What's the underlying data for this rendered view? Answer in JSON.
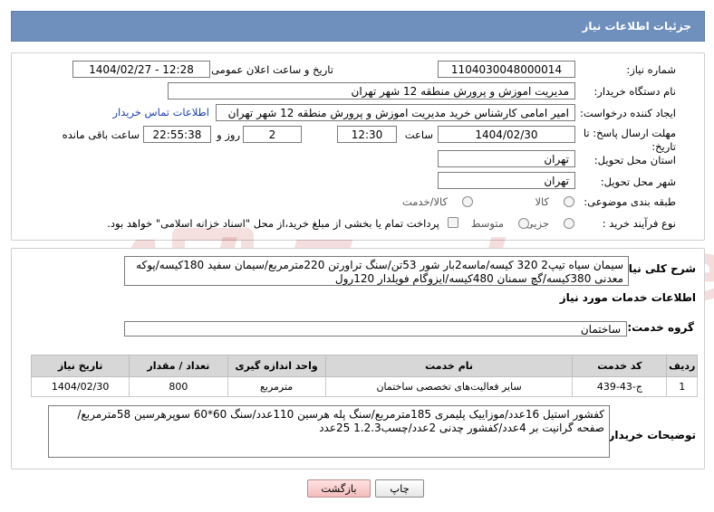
{
  "header": {
    "title": "جزئیات اطلاعات نیاز"
  },
  "fields": {
    "need_number_label": "شماره نیاز:",
    "need_number": "1104030048000014",
    "announce_label": "تاریخ و ساعت اعلان عمومی:",
    "announce_value": "1404/02/27 - 12:28",
    "buyer_org_label": "نام دستگاه خریدار:",
    "buyer_org": "مدیریت اموزش و پرورش منطقه 12 شهر تهران",
    "requester_label": "ایجاد کننده درخواست:",
    "requester": "امیر امامی کارشناس خرید مدیریت اموزش و پرورش منطقه 12 شهر تهران",
    "contact_link": "اطلاعات تماس خریدار",
    "deadline_label": "مهلت ارسال پاسخ: تا تاریخ:",
    "deadline_date": "1404/02/30",
    "time_label": "ساعت",
    "deadline_time": "12:30",
    "days_value": "2",
    "days_label": "روز و",
    "remaining_time": "22:55:38",
    "remaining_label": "ساعت باقی مانده",
    "province_label": "استان محل تحویل:",
    "province": "تهران",
    "city_label": "شهر محل تحویل:",
    "city": "تهران",
    "category_label": "طبقه بندی موضوعی:",
    "category_options": [
      "کالا",
      "کالا/خدمت"
    ],
    "process_label": "نوع فرآیند خرید :",
    "process_options": [
      "جزیی",
      "متوسط"
    ],
    "payment_note": "پرداخت تمام یا بخشی از مبلغ خرید،از محل \"اسناد خزانه اسلامی\" خواهد بود."
  },
  "description": {
    "label": "شرح کلی نیاز:",
    "text": "سیمان سیاه تیپ2 320 کیسه/ماسه2بار شور 53تن/سنگ تراورتن 220مترمربع/سیمان سفید 180کیسه/پوکه معدنی 380کیسه/گچ سمنان 480کیسه/ایزوگام فویلدار 120رول"
  },
  "services": {
    "section_title": "اطلاعات خدمات مورد نیاز",
    "group_label": "گروه خدمت:",
    "group_value": "ساختمان",
    "columns": [
      "ردیف",
      "کد خدمت",
      "نام خدمت",
      "واحد اندازه گیری",
      "تعداد / مقدار",
      "تاریخ نیاز"
    ],
    "rows": [
      [
        "1",
        "ج-43-439",
        "سایر فعالیت‌های تخصصی ساختمان",
        "مترمربع",
        "800",
        "1404/02/30"
      ]
    ]
  },
  "buyer_notes": {
    "label": "توضیحات خریدار:",
    "text": "کفشور استیل 16عدد/موزاییک پلیمری 185مترمربع/سنگ پله هرسین 110عدد/سنگ 60*60 سوپرهرسین 58مترمربع/صفحه گرانیت بر 4عدد/کفشور چدنی 2عدد/چسب1.2.3 25عدد"
  },
  "buttons": {
    "print": "چاپ",
    "back": "بازگشت"
  }
}
